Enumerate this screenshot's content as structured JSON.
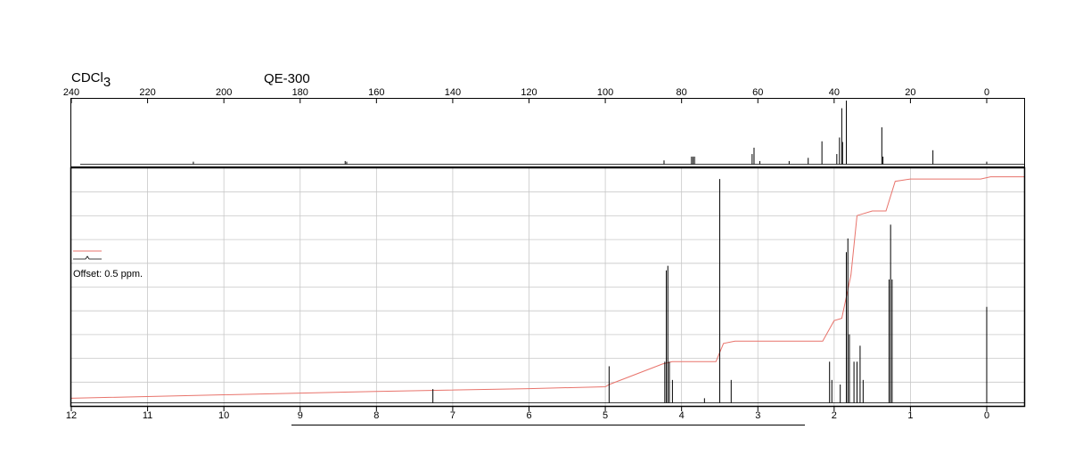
{
  "header": {
    "solvent": "CDCl",
    "solvent_subscript": "3",
    "instrument": "QE-300"
  },
  "annotations": {
    "offset": "Offset: 0.5 ppm."
  },
  "colors": {
    "spectrum": "#000000",
    "integral": "#e8736b",
    "grid": "#c8c8c8",
    "frame": "#000000"
  },
  "chart_data": [
    {
      "type": "line",
      "name": "13C spectrum (top panel)",
      "x_axis": {
        "reversed": true,
        "range": [
          240,
          -10
        ],
        "ticks": [
          240,
          220,
          200,
          180,
          160,
          140,
          120,
          100,
          80,
          60,
          40,
          20,
          0
        ],
        "tick_labels": [
          "240",
          "220",
          "200",
          "180",
          "160",
          "140",
          "120",
          "100",
          "80",
          "60",
          "40",
          "20",
          "0"
        ]
      },
      "y_range": [
        0,
        1
      ],
      "grid": false,
      "peaks": [
        {
          "x": 208.0,
          "h": 0.04
        },
        {
          "x": 168.2,
          "h": 0.05
        },
        {
          "x": 167.8,
          "h": 0.04
        },
        {
          "x": 84.6,
          "h": 0.06
        },
        {
          "x": 77.4,
          "h": 0.12
        },
        {
          "x": 77.0,
          "h": 0.12
        },
        {
          "x": 76.6,
          "h": 0.12
        },
        {
          "x": 61.5,
          "h": 0.16
        },
        {
          "x": 61.0,
          "h": 0.26
        },
        {
          "x": 59.5,
          "h": 0.05
        },
        {
          "x": 51.8,
          "h": 0.05
        },
        {
          "x": 46.8,
          "h": 0.1
        },
        {
          "x": 43.2,
          "h": 0.36
        },
        {
          "x": 39.3,
          "h": 0.16
        },
        {
          "x": 38.6,
          "h": 0.42
        },
        {
          "x": 38.0,
          "h": 0.88
        },
        {
          "x": 37.8,
          "h": 0.35
        },
        {
          "x": 36.8,
          "h": 1.0
        },
        {
          "x": 27.5,
          "h": 0.58
        },
        {
          "x": 27.2,
          "h": 0.12
        },
        {
          "x": 14.1,
          "h": 0.22
        },
        {
          "x": 0.0,
          "h": 0.04
        }
      ]
    },
    {
      "type": "line",
      "name": "1H spectrum (bottom panel)",
      "x_axis": {
        "reversed": true,
        "range": [
          12,
          -0.5
        ],
        "ticks": [
          12,
          11,
          10,
          9,
          8,
          7,
          6,
          5,
          4,
          3,
          2,
          1,
          0
        ],
        "tick_labels": [
          "12",
          "11",
          "10",
          "9",
          "8",
          "7",
          "6",
          "5",
          "4",
          "3",
          "2",
          "1",
          "0"
        ]
      },
      "y_range": [
        0,
        1
      ],
      "grid": true,
      "peaks": [
        {
          "x": 7.26,
          "h": 0.06
        },
        {
          "x": 4.95,
          "h": 0.16
        },
        {
          "x": 4.22,
          "h": 0.18
        },
        {
          "x": 4.2,
          "h": 0.58
        },
        {
          "x": 4.18,
          "h": 0.6
        },
        {
          "x": 4.16,
          "h": 0.18
        },
        {
          "x": 4.12,
          "h": 0.1
        },
        {
          "x": 3.7,
          "h": 0.02
        },
        {
          "x": 3.5,
          "h": 0.98
        },
        {
          "x": 3.35,
          "h": 0.1
        },
        {
          "x": 2.06,
          "h": 0.18
        },
        {
          "x": 2.03,
          "h": 0.1
        },
        {
          "x": 1.92,
          "h": 0.08
        },
        {
          "x": 1.84,
          "h": 0.66
        },
        {
          "x": 1.82,
          "h": 0.72
        },
        {
          "x": 1.8,
          "h": 0.3
        },
        {
          "x": 1.74,
          "h": 0.18
        },
        {
          "x": 1.7,
          "h": 0.18
        },
        {
          "x": 1.66,
          "h": 0.25
        },
        {
          "x": 1.62,
          "h": 0.1
        },
        {
          "x": 1.28,
          "h": 0.54
        },
        {
          "x": 1.26,
          "h": 0.78
        },
        {
          "x": 1.24,
          "h": 0.54
        },
        {
          "x": 0.0,
          "h": 0.42
        }
      ],
      "integral_curve": {
        "x": [
          12,
          10,
          8,
          6,
          5.0,
          4.95,
          4.25,
          4.12,
          3.55,
          3.45,
          3.3,
          2.15,
          2.0,
          1.9,
          1.78,
          1.7,
          1.5,
          1.32,
          1.2,
          1.0,
          0.08,
          -0.05,
          -0.5
        ],
        "y": [
          0.02,
          0.035,
          0.05,
          0.062,
          0.07,
          0.08,
          0.17,
          0.18,
          0.18,
          0.26,
          0.27,
          0.27,
          0.36,
          0.37,
          0.56,
          0.82,
          0.84,
          0.84,
          0.97,
          0.98,
          0.98,
          0.99,
          0.99
        ]
      }
    }
  ]
}
